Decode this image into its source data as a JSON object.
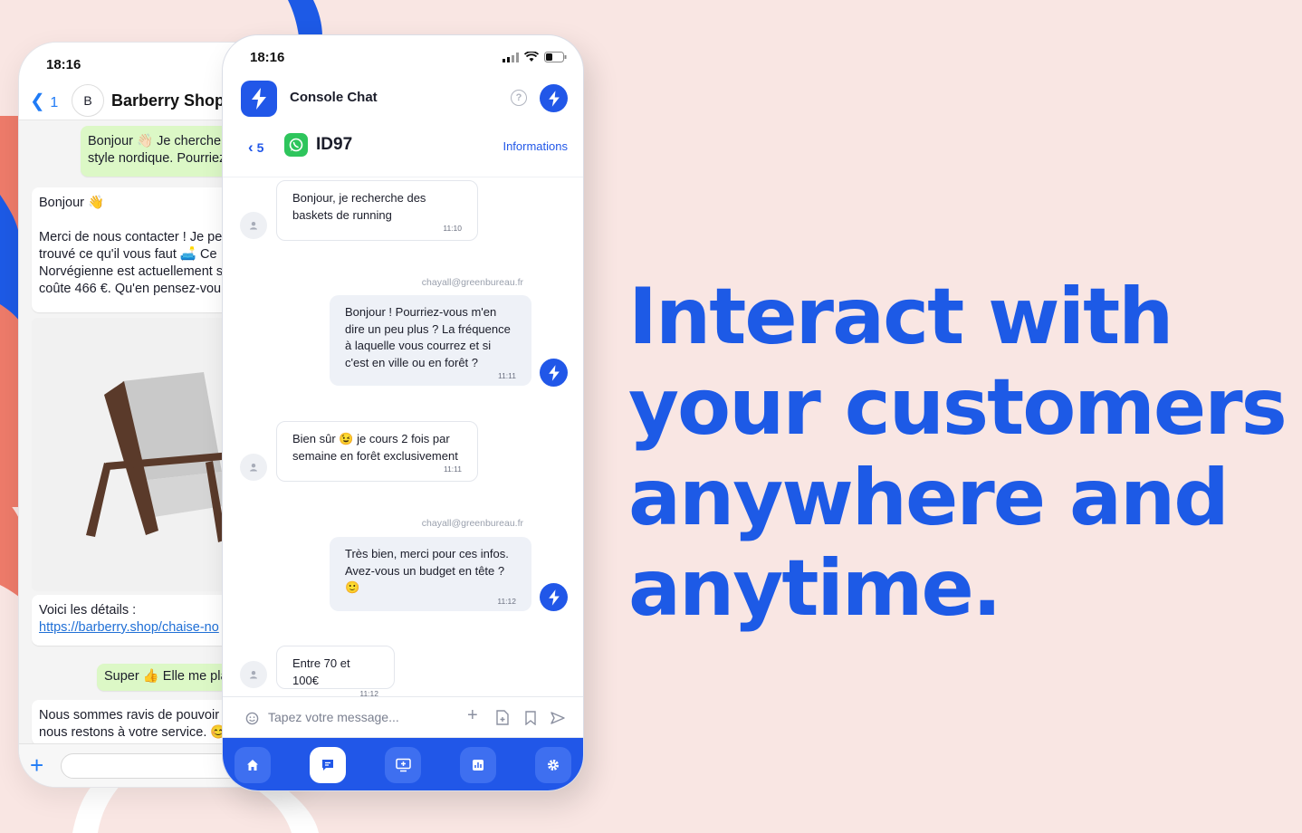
{
  "back_phone": {
    "time": "18:16",
    "back_count": "1",
    "contact_name": "Barberry Shop",
    "avatar_glyph": "B",
    "messages": [
      {
        "dir": "out",
        "text": "Bonjour 👋🏻 Je cherche\nstyle nordique. Pourriez"
      },
      {
        "dir": "in",
        "text": "Bonjour 👋\n\nMerci de nous contacter ! Je pe\ntrouvé ce qu'il vous faut 🛋️ Ce\nNorvégienne est actuellement s\ncoûte 466 €. Qu'en pensez-vou"
      },
      {
        "dir": "in",
        "text": "Voici les détails :",
        "link": "https://barberry.shop/chaise-no"
      },
      {
        "dir": "out",
        "text": "Super 👍 Elle me pla"
      },
      {
        "dir": "in",
        "text": "Nous sommes ravis de pouvoir\nnous restons à votre service. 😊"
      }
    ],
    "icons": {
      "back": "chevron-left-icon",
      "plus": "plus-icon"
    }
  },
  "front_phone": {
    "time": "18:16",
    "app_name": "Console Chat",
    "back_count": "5",
    "conversation_id": "ID97",
    "info_link": "Informations",
    "composer_placeholder": "Tapez votre message...",
    "messages": [
      {
        "dir": "in",
        "text": "Bonjour, je recherche des\nbaskets de running",
        "time": "11:10"
      },
      {
        "dir": "out",
        "sender": "chayall@greenbureau.fr",
        "text": "Bonjour ! Pourriez-vous m'en\ndire un peu plus ? La fréquence\nà laquelle vous courrez et si\nc'est en ville ou en forêt ?",
        "time": "11:11"
      },
      {
        "dir": "in",
        "text": "Bien sûr 😉 je cours 2 fois par\nsemaine en forêt exclusivement",
        "time": "11:11"
      },
      {
        "dir": "out",
        "sender": "chayall@greenbureau.fr",
        "text": "Très bien, merci pour ces infos.\nAvez-vous un budget en tête ?\n🙂",
        "time": "11:12"
      },
      {
        "dir": "in",
        "text": "Entre 70 et 100€",
        "time": "11:12"
      }
    ],
    "nav": [
      {
        "name": "home-icon",
        "active": false
      },
      {
        "name": "chat-icon",
        "active": true
      },
      {
        "name": "monitor-icon",
        "active": false
      },
      {
        "name": "stats-icon",
        "active": false
      },
      {
        "name": "settings-icon",
        "active": false
      }
    ],
    "colors": {
      "brand": "#2157e8",
      "whatsapp": "#2ec55c",
      "out_bubble": "#eef1f7"
    }
  },
  "headline": "Interact with your customers anywhere and anytime.",
  "colors": {
    "background": "#f9e6e3",
    "headline": "#1d5ae6",
    "coral": "#ee7b6a"
  }
}
